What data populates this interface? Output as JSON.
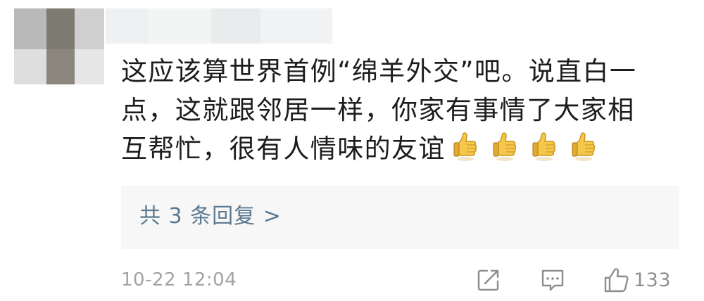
{
  "comment": {
    "lines": [
      "这应该算世界首例“绵羊外交”吧。说直白一",
      "点，这就跟邻居一样，你家有事情了大家相",
      "互帮忙，很有人情味的友谊"
    ],
    "emoji": "thumbs-up-icon",
    "emoji_count": 4
  },
  "replies": {
    "label": "共 3 条回复 >"
  },
  "footer": {
    "timestamp": "10-22 12:04",
    "like_count": "133"
  },
  "colors": {
    "text": "#1d1d1d",
    "reply_link": "#5b7a92",
    "muted": "#a3a3a3",
    "reply_box_bg": "#f7f7f7"
  }
}
